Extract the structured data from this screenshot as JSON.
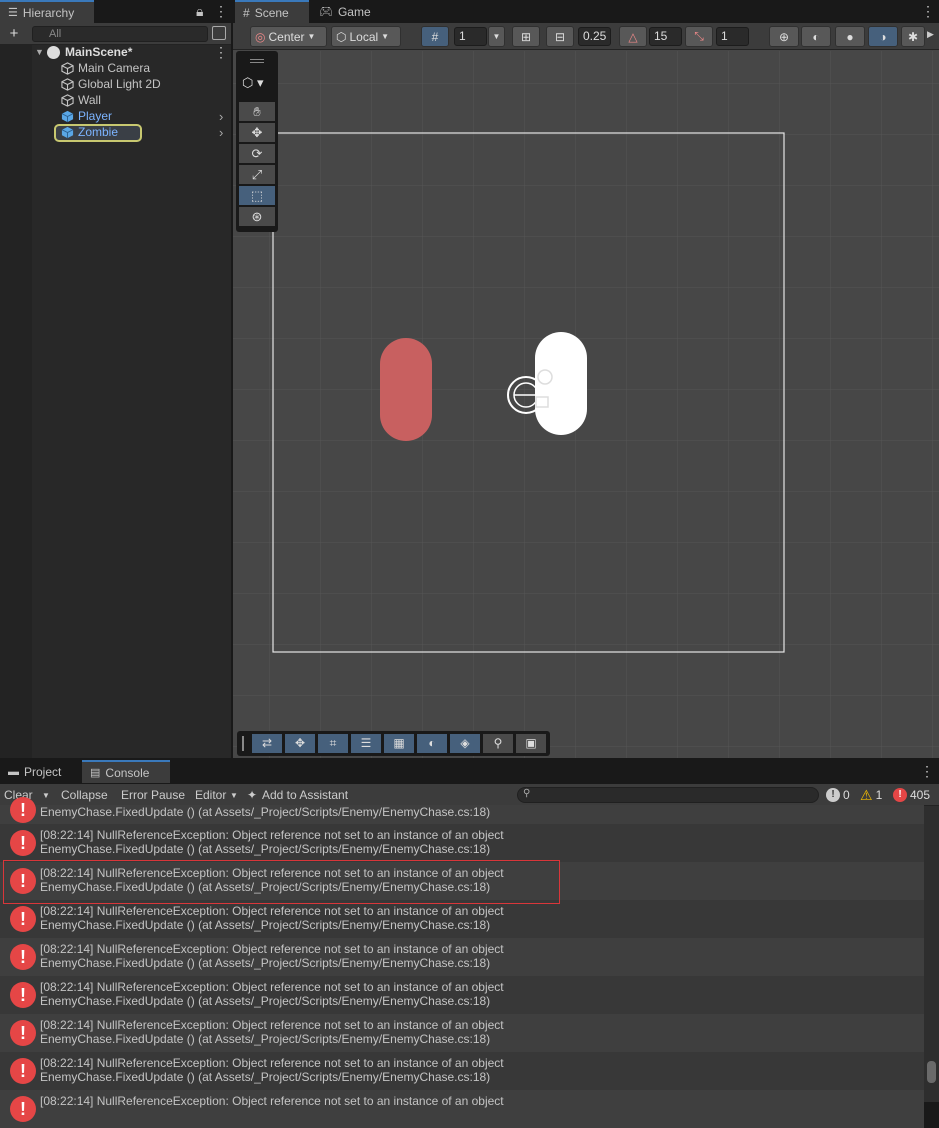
{
  "hierarchy": {
    "tab_label": "Hierarchy",
    "add_label": "+",
    "search_placeholder": "All",
    "items": [
      {
        "label": "MainScene*"
      },
      {
        "label": "Main Camera"
      },
      {
        "label": "Global Light 2D"
      },
      {
        "label": "Wall"
      },
      {
        "label": "Player"
      },
      {
        "label": "Zombie"
      }
    ]
  },
  "scene": {
    "tabs": [
      {
        "label": "Scene"
      },
      {
        "label": "Game"
      }
    ],
    "pivot_mode": "Center",
    "pivot_rotation": "Local",
    "grid_value": "1",
    "snap_increment": "0.25",
    "rotation_snap": "15",
    "scale_snap": "1"
  },
  "console": {
    "tabs": [
      {
        "label": "Project"
      },
      {
        "label": "Console"
      }
    ],
    "clear_label": "Clear",
    "collapse_label": "Collapse",
    "error_pause_label": "Error Pause",
    "editor_label": "Editor",
    "assistant_label": "Add to Assistant",
    "info_count": "0",
    "warning_count": "1",
    "error_count": "405",
    "first_partial_line": "EnemyChase.FixedUpdate () (at Assets/_Project/Scripts/Enemy/EnemyChase.cs:18)",
    "entries": [
      {
        "line1": "[08:22:14] NullReferenceException: Object reference not set to an instance of an object",
        "line2": "EnemyChase.FixedUpdate () (at Assets/_Project/Scripts/Enemy/EnemyChase.cs:18)"
      },
      {
        "line1": "[08:22:14] NullReferenceException: Object reference not set to an instance of an object",
        "line2": "EnemyChase.FixedUpdate () (at Assets/_Project/Scripts/Enemy/EnemyChase.cs:18)"
      },
      {
        "line1": "[08:22:14] NullReferenceException: Object reference not set to an instance of an object",
        "line2": "EnemyChase.FixedUpdate () (at Assets/_Project/Scripts/Enemy/EnemyChase.cs:18)"
      },
      {
        "line1": "[08:22:14] NullReferenceException: Object reference not set to an instance of an object",
        "line2": "EnemyChase.FixedUpdate () (at Assets/_Project/Scripts/Enemy/EnemyChase.cs:18)"
      },
      {
        "line1": "[08:22:14] NullReferenceException: Object reference not set to an instance of an object",
        "line2": "EnemyChase.FixedUpdate () (at Assets/_Project/Scripts/Enemy/EnemyChase.cs:18)"
      },
      {
        "line1": "[08:22:14] NullReferenceException: Object reference not set to an instance of an object",
        "line2": "EnemyChase.FixedUpdate () (at Assets/_Project/Scripts/Enemy/EnemyChase.cs:18)"
      },
      {
        "line1": "[08:22:14] NullReferenceException: Object reference not set to an instance of an object",
        "line2": "EnemyChase.FixedUpdate () (at Assets/_Project/Scripts/Enemy/EnemyChase.cs:18)"
      },
      {
        "line1": "[08:22:14] NullReferenceException: Object reference not set to an instance of an object",
        "line2": ""
      }
    ]
  },
  "colors": {
    "accent": "#3a79bb",
    "error": "#e54646",
    "warning": "#f4bc02",
    "player_capsule": "#c86060",
    "zombie_capsule": "#ffffff",
    "selection_outline": "#c8c870"
  }
}
